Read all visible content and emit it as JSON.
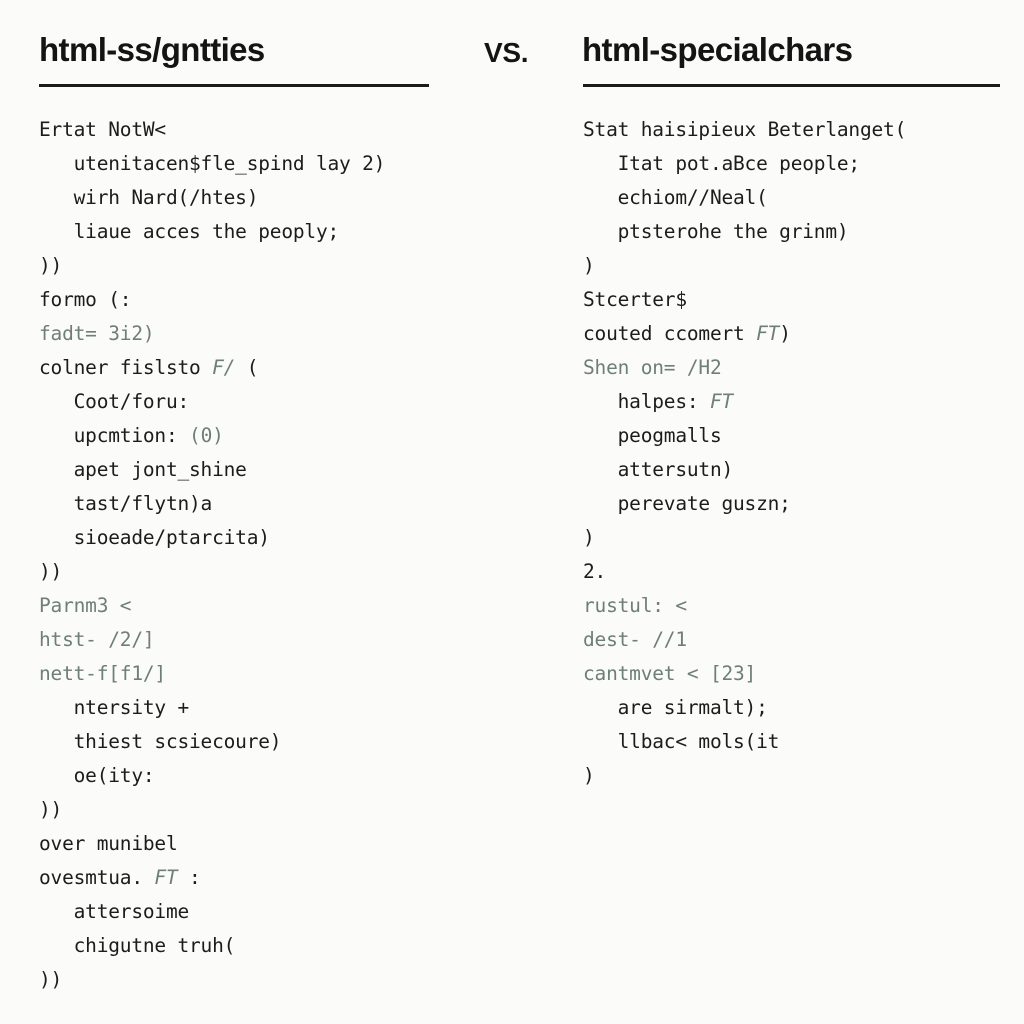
{
  "header": {
    "left_title": "html-ss/gntties",
    "vs_label": "VS.",
    "right_title": "html-specialchars",
    "rule_color": "#1b1b1b"
  },
  "theme": {
    "background": "#fbfbfa",
    "text_color": "#1c1c1c",
    "accent_green": "#6e7f74",
    "title_color": "#141414"
  },
  "left_code": {
    "lines": [
      {
        "text": "Ertat NotW<",
        "style": "plain"
      },
      {
        "text": "   utenitacen$fle_spind lay 2)",
        "style": "plain"
      },
      {
        "text": "   wirh Nard(/htes)",
        "style": "plain"
      },
      {
        "text": "   liaue acces the peoply;",
        "style": "plain"
      },
      {
        "text": "))",
        "style": "plain"
      },
      {
        "text": "formo (:",
        "style": "plain"
      },
      {
        "text": "fadt= 3i2)",
        "style": "green"
      },
      {
        "text": "colner fislsto F/ (",
        "style": "mixed-italic-green",
        "plain_head": "colner fislsto ",
        "green_part": "F/",
        "plain_tail": " ("
      },
      {
        "text": "   Coot/foru:",
        "style": "plain"
      },
      {
        "text": "   upcmtion: (0)",
        "style": "mixed-green-tail",
        "plain_head": "   upcmtion: ",
        "green_part": "(0)",
        "plain_tail": ""
      },
      {
        "text": "   apet jont_shine",
        "style": "plain"
      },
      {
        "text": "   tast/flytn)a",
        "style": "plain"
      },
      {
        "text": "   sioeade/ptarcita)",
        "style": "plain"
      },
      {
        "text": "))",
        "style": "plain"
      },
      {
        "text": "Parnm3 <",
        "style": "green"
      },
      {
        "text": "htst- /2/]",
        "style": "green"
      },
      {
        "text": "nett-f[f1/]",
        "style": "green"
      },
      {
        "text": "   ntersity +",
        "style": "plain"
      },
      {
        "text": "   thiest scsiecoure)",
        "style": "plain"
      },
      {
        "text": "   oe(ity:",
        "style": "plain"
      },
      {
        "text": "))",
        "style": "plain"
      },
      {
        "text": "over munibel",
        "style": "plain"
      },
      {
        "text": "ovesmtua. FT :",
        "style": "mixed-italic-green",
        "plain_head": "ovesmtua. ",
        "green_part": "FT",
        "plain_tail": " :"
      },
      {
        "text": "   attersoime",
        "style": "plain"
      },
      {
        "text": "   chigutne truh(",
        "style": "plain"
      },
      {
        "text": "))",
        "style": "plain"
      }
    ]
  },
  "right_code": {
    "lines": [
      {
        "text": "Stat haisipieux Beterlanget(",
        "style": "plain"
      },
      {
        "text": "   Itat pot.aBce people;",
        "style": "plain"
      },
      {
        "text": "   echiom//Neal(",
        "style": "plain"
      },
      {
        "text": "   ptsterohe the grinm)",
        "style": "plain"
      },
      {
        "text": ")",
        "style": "plain"
      },
      {
        "text": "Stcerter$",
        "style": "plain"
      },
      {
        "text": "couted ccomert FT)",
        "style": "mixed-italic-green",
        "plain_head": "couted ccomert ",
        "green_part": "FT",
        "plain_tail": ")"
      },
      {
        "text": "Shen on= /H2",
        "style": "green"
      },
      {
        "text": "   halpes: FT",
        "style": "mixed-italic-green",
        "plain_head": "   halpes: ",
        "green_part": "FT",
        "plain_tail": ""
      },
      {
        "text": "   peogmalls",
        "style": "plain"
      },
      {
        "text": "   attersutn)",
        "style": "plain"
      },
      {
        "text": "   perevate guszn;",
        "style": "plain"
      },
      {
        "text": ")",
        "style": "plain"
      },
      {
        "text": "2.",
        "style": "plain"
      },
      {
        "text": "rustul: <",
        "style": "green"
      },
      {
        "text": "dest- //1",
        "style": "green"
      },
      {
        "text": "cantmvet < [23]",
        "style": "green"
      },
      {
        "text": "   are sirmalt);",
        "style": "plain"
      },
      {
        "text": "   llbac< mols(it",
        "style": "plain"
      },
      {
        "text": ")",
        "style": "plain"
      }
    ]
  }
}
